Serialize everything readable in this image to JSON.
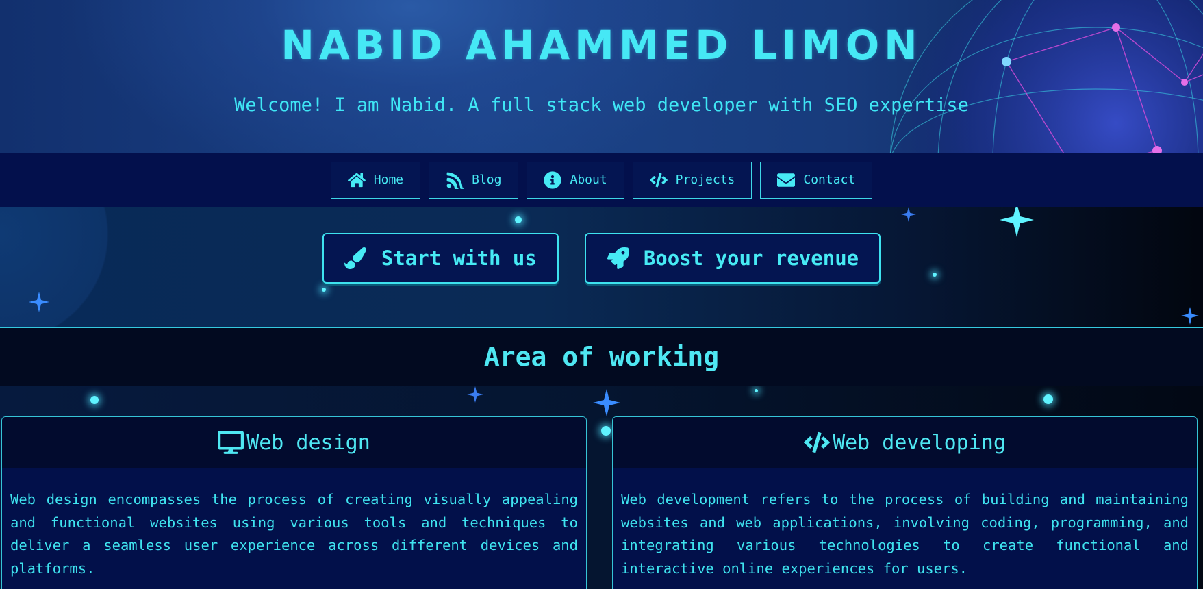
{
  "header": {
    "title": "NABID AHAMMED LIMON",
    "tagline": "Welcome! I am Nabid. A full stack web developer with SEO expertise"
  },
  "nav": {
    "items": [
      {
        "label": "Home",
        "icon": "home-icon"
      },
      {
        "label": "Blog",
        "icon": "rss-icon"
      },
      {
        "label": "About",
        "icon": "info-icon"
      },
      {
        "label": "Projects",
        "icon": "code-icon"
      },
      {
        "label": "Contact",
        "icon": "envelope-icon"
      }
    ]
  },
  "hero": {
    "buttons": [
      {
        "label": "Start with us",
        "icon": "paintbrush-icon"
      },
      {
        "label": "Boost your revenue",
        "icon": "rocket-icon"
      }
    ]
  },
  "section": {
    "title": "Area of working"
  },
  "cards": [
    {
      "title": "Web design",
      "icon": "desktop-icon",
      "text": "Web design encompasses the process of creating visually appealing and functional websites using various tools and techniques to deliver a seamless user experience across different devices and platforms."
    },
    {
      "title": "Web developing",
      "icon": "code-icon",
      "text": "Web development refers to the process of building and maintaining websites and web applications, involving coding, programming, and integrating various technologies to create functional and interactive online experiences for users."
    }
  ],
  "colors": {
    "accent": "#47eaf4",
    "nav_bg": "#03104c",
    "card_bg": "#02104a",
    "header_bg": "#1c4489"
  }
}
